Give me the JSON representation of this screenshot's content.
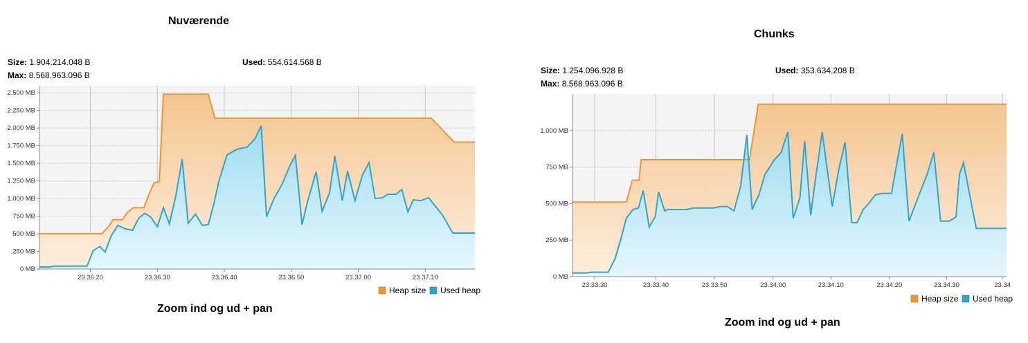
{
  "colors": {
    "heap_size": "#f0962e",
    "used_heap": "#2ba6cf",
    "heap_fill_top": "#f3c590",
    "heap_fill_bottom": "#fdeedd",
    "used_fill_top": "#9ddcf0",
    "used_fill_bottom": "#e6f6fc",
    "grid": "#c8c8c8",
    "plot_bg": "#f4f4f4"
  },
  "left": {
    "title": "Nuværende",
    "size_label": "Size:",
    "size_value": "1.904.214.048 B",
    "max_label": "Max:",
    "max_value": "8.568.963.096 B",
    "used_label": "Used:",
    "used_value": "554.614.568 B",
    "caption": "Zoom ind og ud + pan"
  },
  "right": {
    "title": "Chunks",
    "size_label": "Size:",
    "size_value": "1.254.096.928 B",
    "max_label": "Max:",
    "max_value": "8.568.963.096 B",
    "used_label": "Used:",
    "used_value": "353.634.208 B",
    "caption": "Zoom ind og ud + pan"
  },
  "chart_data": [
    {
      "type": "area",
      "title": "Nuværende",
      "x_unit": "seconds",
      "xlim": [
        0,
        65
      ],
      "ylim": [
        0,
        2600
      ],
      "y_ticks": [
        0,
        250,
        500,
        750,
        1000,
        1250,
        1500,
        1750,
        2000,
        2250,
        2500
      ],
      "y_tick_labels": [
        "0 MB",
        "250 MB",
        "500 MB",
        "750 MB",
        "1.000 MB",
        "1.250 MB",
        "1.500 MB",
        "1.750 MB",
        "2.000 MB",
        "2.250 MB",
        "2.500 MB"
      ],
      "x_ticks": [
        7.6,
        17.6,
        27.6,
        37.6,
        47.6,
        57.6
      ],
      "x_tick_labels": [
        "23.36.20",
        "23.36.30",
        "23.36.40",
        "23.36.50",
        "23.37.00",
        "23.37.10"
      ],
      "grid": true,
      "legend": [
        "Heap size",
        "Used heap"
      ],
      "legend_position": "bottom-right",
      "series": [
        {
          "name": "Heap size",
          "x": [
            0,
            9.3,
            10.3,
            11.0,
            12.4,
            13.1,
            14.0,
            14.8,
            15.6,
            16.3,
            17.1,
            17.9,
            18.5,
            19.0,
            25.2,
            26.2,
            29.0,
            32.0,
            35.0,
            38.0,
            42.0,
            47.0,
            52.0,
            56.0,
            58.5,
            61.9,
            65.0
          ],
          "y": [
            500,
            500,
            600,
            700,
            700,
            800,
            870,
            870,
            870,
            1050,
            1220,
            1240,
            2480,
            2480,
            2480,
            2140,
            2140,
            2140,
            2140,
            2140,
            2140,
            2140,
            2140,
            2140,
            2140,
            1800,
            1800
          ]
        },
        {
          "name": "Used heap",
          "x": [
            0,
            1.5,
            2.2,
            7.1,
            8.0,
            9.0,
            9.8,
            10.7,
            11.7,
            12.8,
            13.9,
            14.8,
            15.7,
            16.6,
            17.6,
            18.5,
            19.4,
            20.4,
            21.3,
            22.2,
            23.3,
            24.3,
            25.2,
            26.1,
            26.8,
            28.0,
            29.5,
            31.0,
            32.2,
            33.1,
            33.9,
            35.0,
            36.2,
            37.4,
            38.2,
            39.2,
            40.0,
            41.3,
            42.2,
            43.3,
            44.1,
            45.2,
            46.0,
            47.1,
            48.2,
            49.2,
            50.1,
            51.2,
            52.0,
            53.2,
            54.1,
            55.0,
            55.8,
            56.9,
            58.1,
            60.2,
            61.7,
            63.0,
            65.0
          ],
          "y": [
            30,
            30,
            40,
            40,
            260,
            320,
            240,
            470,
            620,
            570,
            550,
            720,
            790,
            740,
            600,
            870,
            640,
            1060,
            1560,
            650,
            780,
            620,
            630,
            950,
            1250,
            1620,
            1700,
            1730,
            1850,
            2030,
            740,
            1000,
            1200,
            1470,
            1610,
            630,
            950,
            1380,
            820,
            1080,
            1600,
            970,
            1390,
            970,
            1330,
            1510,
            1000,
            1010,
            1060,
            1060,
            1130,
            810,
            980,
            970,
            1010,
            760,
            510,
            510,
            510
          ]
        }
      ]
    },
    {
      "type": "area",
      "title": "Chunks",
      "x_unit": "seconds",
      "xlim": [
        0,
        64.5
      ],
      "ylim": [
        0,
        1250
      ],
      "y_ticks": [
        0,
        250,
        500,
        750,
        1000
      ],
      "y_tick_labels": [
        "0 MB",
        "250 MB",
        "500 MB",
        "750 MB",
        "1.000 MB"
      ],
      "x_ticks": [
        3.3,
        12.4,
        21.1,
        29.8,
        38.4,
        47.1,
        55.6,
        63.9
      ],
      "x_tick_labels": [
        "23.33.30",
        "23.33.40",
        "23.33.50",
        "23.34.00",
        "23.34.10",
        "23.34.20",
        "23.34.30",
        "23.34"
      ],
      "grid": true,
      "legend": [
        "Heap size",
        "Used heap"
      ],
      "legend_position": "bottom-right",
      "series": [
        {
          "name": "Heap size",
          "x": [
            0,
            7.2,
            8.0,
            8.9,
            9.9,
            10.2,
            18.0,
            25.0,
            25.8,
            26.3,
            27.6,
            33.0,
            42.0,
            52.0,
            60.0,
            64.5
          ],
          "y": [
            510,
            510,
            510,
            660,
            660,
            800,
            800,
            800,
            800,
            800,
            1180,
            1180,
            1180,
            1180,
            1180,
            1180
          ],
          "note_ignore": false
        },
        {
          "name": "Used heap",
          "x": [
            0,
            2.0,
            2.8,
            5.3,
            6.3,
            7.2,
            8.0,
            9.0,
            9.8,
            10.5,
            11.4,
            12.3,
            12.8,
            13.7,
            14.2,
            14.9,
            17.0,
            18.0,
            20.0,
            21.0,
            22.0,
            23.0,
            24.0,
            25.0,
            25.9,
            26.7,
            27.7,
            28.6,
            30.0,
            31.0,
            32.0,
            32.8,
            33.8,
            34.5,
            35.4,
            36.2,
            37.1,
            38.6,
            39.6,
            40.5,
            41.5,
            42.3,
            43.2,
            44.0,
            45.0,
            46.0,
            47.4,
            49.0,
            50.0,
            51.5,
            52.7,
            53.7,
            54.7,
            56.0,
            57.0,
            57.5,
            58.1,
            60.0,
            64.5
          ],
          "y": [
            25,
            25,
            30,
            30,
            120,
            260,
            400,
            460,
            470,
            590,
            340,
            410,
            580,
            450,
            460,
            460,
            460,
            470,
            470,
            470,
            480,
            480,
            450,
            620,
            970,
            460,
            560,
            700,
            800,
            850,
            990,
            400,
            540,
            930,
            420,
            700,
            990,
            480,
            740,
            920,
            370,
            370,
            460,
            500,
            560,
            570,
            570,
            980,
            380,
            560,
            700,
            850,
            380,
            380,
            410,
            700,
            780,
            330,
            330
          ]
        }
      ]
    }
  ]
}
